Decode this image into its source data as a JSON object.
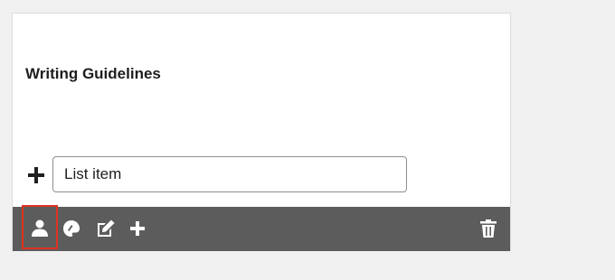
{
  "block": {
    "title": "Writing Guidelines",
    "list_input": {
      "placeholder": "List item",
      "value": ""
    }
  },
  "toolbar": {
    "buttons": [
      {
        "icon": "person-icon"
      },
      {
        "icon": "palette-icon"
      },
      {
        "icon": "edit-icon"
      },
      {
        "icon": "plus-icon"
      },
      {
        "icon": "trash-icon"
      }
    ],
    "highlight_color": "#e0311f",
    "background": "#5c5c5c"
  }
}
